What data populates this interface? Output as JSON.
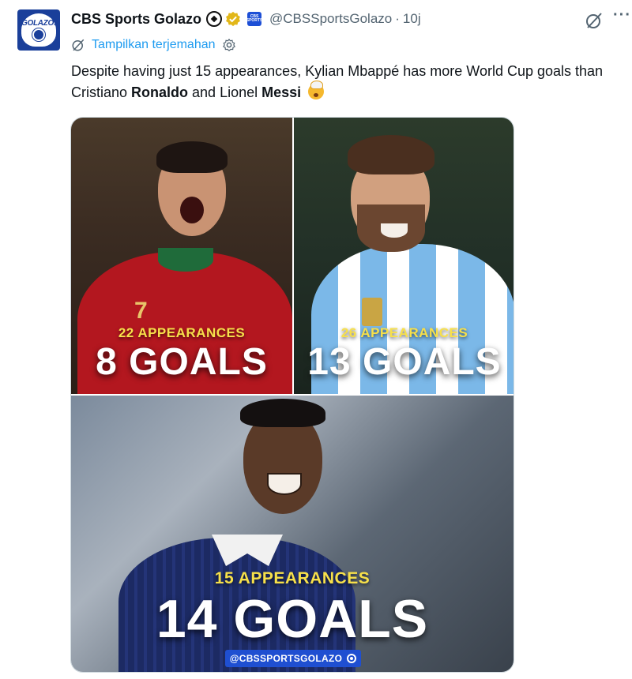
{
  "author": {
    "display_name": "CBS Sports Golazo",
    "handle": "@CBSSportsGolazo",
    "separator": "·",
    "time": "10j",
    "avatar_text": "GOLAZO!"
  },
  "icons": {
    "emoji": "soccer-ball-icon",
    "verified": "gold-verified-badge-icon",
    "affiliate": "cbs-sports-affiliate-badge-icon",
    "grok": "grok-icon",
    "more": "more-options-icon",
    "translate": "translate-icon",
    "settings": "gear-icon"
  },
  "translate": {
    "label": "Tampilkan terjemahan"
  },
  "tweet": {
    "part1": "Despite having just 15 appearances, Kylian Mbappé has more World Cup goals than Cristiano ",
    "bold1": "Ronaldo",
    "part2": " and Lionel ",
    "bold2": "Messi"
  },
  "media": {
    "panels": [
      {
        "appearances": "22 APPEARANCES",
        "goals": "8 GOALS",
        "jersey_number": "7"
      },
      {
        "appearances": "26 APPEARANCES",
        "goals": "13 GOALS"
      },
      {
        "appearances": "15 APPEARANCES",
        "goals": "14 GOALS"
      }
    ],
    "watermark": "@CBSSPORTSGOLAZO"
  },
  "colors": {
    "link_blue": "#1d9bf0",
    "stat_yellow": "#f7e04a",
    "brand_blue": "#1f4fd1"
  }
}
